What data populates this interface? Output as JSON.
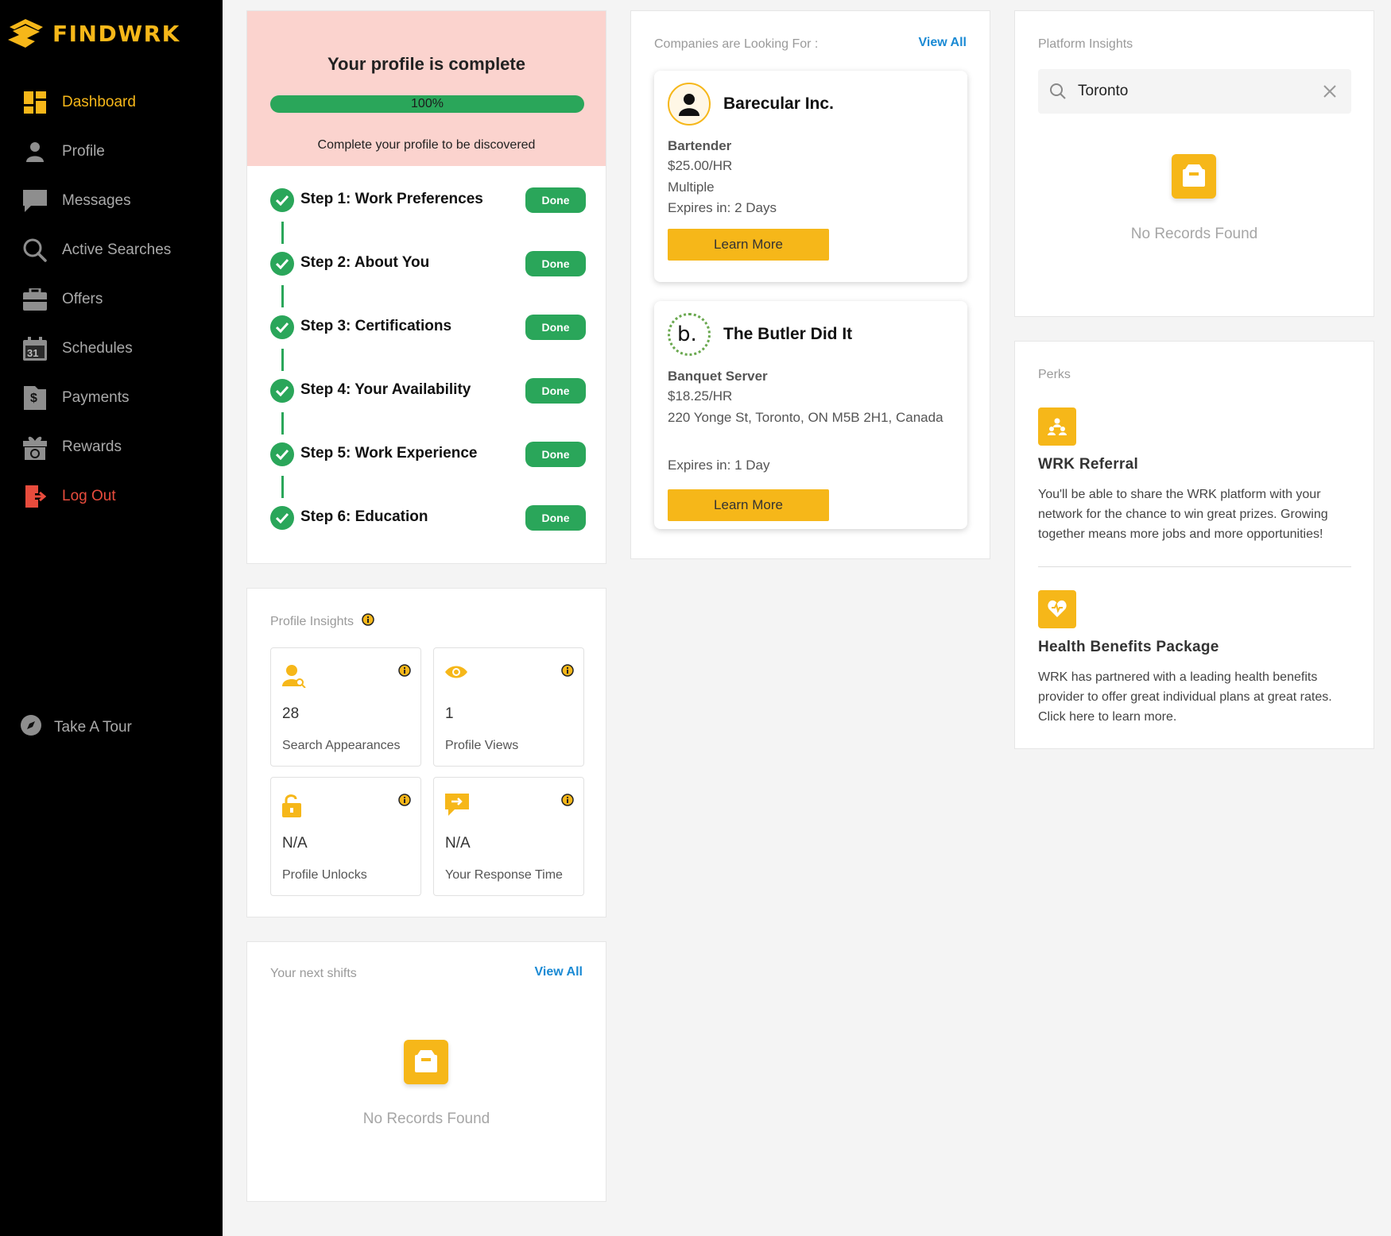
{
  "brand": {
    "name": "FINDWRK",
    "color": "#f6b719"
  },
  "sidebar": {
    "items": [
      {
        "label": "Dashboard",
        "icon": "dashboard-icon",
        "active": true
      },
      {
        "label": "Profile",
        "icon": "user-icon"
      },
      {
        "label": "Messages",
        "icon": "chat-icon"
      },
      {
        "label": "Active Searches",
        "icon": "search-icon"
      },
      {
        "label": "Offers",
        "icon": "briefcase-icon"
      },
      {
        "label": "Schedules",
        "icon": "calendar-icon",
        "icon_text": "31"
      },
      {
        "label": "Payments",
        "icon": "dollar-file-icon",
        "icon_text": "$"
      },
      {
        "label": "Rewards",
        "icon": "gift-icon"
      },
      {
        "label": "Log Out",
        "icon": "logout-icon"
      }
    ],
    "tour": {
      "label": "Take A Tour",
      "icon": "compass-icon"
    }
  },
  "profile": {
    "title": "Your profile is complete",
    "progress_text": "100%",
    "progress": 1.0,
    "subtitle": "Complete your profile to be discovered",
    "steps": [
      {
        "label": "Step 1: Work Preferences",
        "status": "Done"
      },
      {
        "label": "Step 2: About You",
        "status": "Done"
      },
      {
        "label": "Step 3: Certifications",
        "status": "Done"
      },
      {
        "label": "Step 4: Your Availability",
        "status": "Done"
      },
      {
        "label": "Step 5: Work Experience",
        "status": "Done"
      },
      {
        "label": "Step 6: Education",
        "status": "Done"
      }
    ]
  },
  "insights": {
    "title": "Profile Insights",
    "tiles": [
      {
        "value": "28",
        "label": "Search Appearances",
        "icon": "person-search-icon"
      },
      {
        "value": "1",
        "label": "Profile Views",
        "icon": "eye-icon"
      },
      {
        "value": "N/A",
        "label": "Profile Unlocks",
        "icon": "unlock-icon"
      },
      {
        "value": "N/A",
        "label": "Your Response Time",
        "icon": "reply-icon"
      }
    ]
  },
  "shifts": {
    "title": "Your next shifts",
    "view_all": "View All",
    "empty": "No Records Found"
  },
  "companies": {
    "title": "Companies are Looking For :",
    "view_all": "View All",
    "jobs": [
      {
        "company": "Barecular Inc.",
        "role": "Bartender",
        "rate": "$25.00/HR",
        "location": "Multiple",
        "expires": "Expires in: 2 Days",
        "button": "Learn More",
        "logo_text": ""
      },
      {
        "company": "The Butler Did It",
        "role": "Banquet Server",
        "rate": "$18.25/HR",
        "location": "220 Yonge St, Toronto, ON M5B 2H1, Canada",
        "expires": "Expires in: 1 Day",
        "button": "Learn More",
        "logo_text": "b."
      }
    ]
  },
  "platform": {
    "title": "Platform Insights",
    "search_value": "Toronto",
    "empty": "No Records Found"
  },
  "perks": {
    "title": "Perks",
    "items": [
      {
        "title": "WRK Referral",
        "icon": "referral-icon",
        "desc": "You'll be able to share the WRK platform with your network for the chance to win great prizes. Growing together means more jobs and more opportunities!"
      },
      {
        "title": "Health Benefits Package",
        "icon": "health-heart-icon",
        "desc": "WRK has partnered with a leading health benefits provider to offer great individual plans at great rates. Click here to learn more."
      }
    ]
  },
  "colors": {
    "success": "#2aa65a",
    "accent": "#f6b719",
    "link": "#1a8ad4",
    "danger": "#e84c3d"
  }
}
